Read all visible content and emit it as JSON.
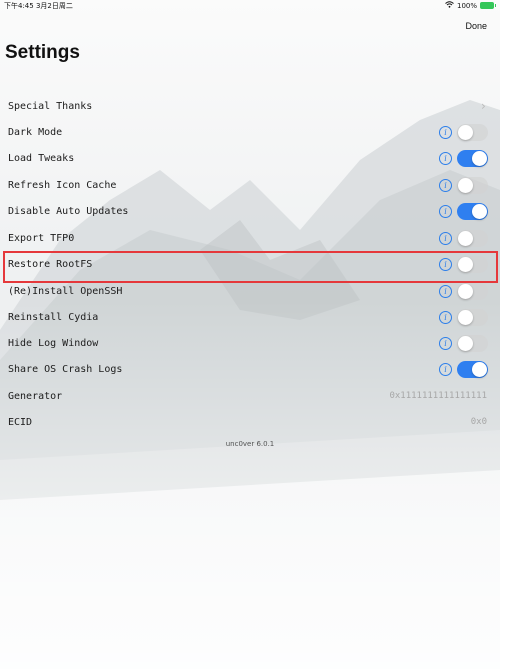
{
  "status_bar": {
    "time": "下午4:45  3月2日周二",
    "battery": "100%"
  },
  "header": {
    "done_label": "Done",
    "title": "Settings"
  },
  "rows": [
    {
      "label": "Special Thanks",
      "type": "chevron"
    },
    {
      "label": "Dark Mode",
      "type": "toggle",
      "on": false
    },
    {
      "label": "Load Tweaks",
      "type": "toggle",
      "on": true
    },
    {
      "label": "Refresh Icon Cache",
      "type": "toggle",
      "on": false
    },
    {
      "label": "Disable Auto Updates",
      "type": "toggle",
      "on": true
    },
    {
      "label": "Export TFP0",
      "type": "toggle",
      "on": false
    },
    {
      "label": "Restore RootFS",
      "type": "toggle",
      "on": false,
      "highlighted": true
    },
    {
      "label": "(Re)Install OpenSSH",
      "type": "toggle",
      "on": false
    },
    {
      "label": "Reinstall Cydia",
      "type": "toggle",
      "on": false
    },
    {
      "label": "Hide Log Window",
      "type": "toggle",
      "on": false
    },
    {
      "label": "Share OS Crash Logs",
      "type": "toggle",
      "on": true
    },
    {
      "label": "Generator",
      "type": "value",
      "value": "0x1111111111111111"
    },
    {
      "label": "ECID",
      "type": "value",
      "value": "0x0"
    }
  ],
  "footer": {
    "version": "unc0ver 6.0.1"
  },
  "colors": {
    "accent": "#2f7ff0",
    "highlight": "#e5383b"
  },
  "icons": {
    "info": "info-circle-icon",
    "chevron": "chevron-right-icon",
    "wifi": "wifi-icon",
    "battery": "battery-icon"
  }
}
